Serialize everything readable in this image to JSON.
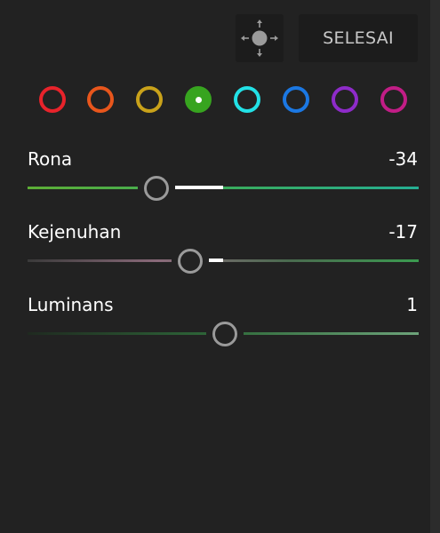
{
  "toolbar": {
    "target_icon": "target-adjust-icon",
    "done_label": "SELESAI"
  },
  "color_swatches": [
    {
      "name": "red",
      "color": "#e8232b",
      "selected": false
    },
    {
      "name": "orange",
      "color": "#e8561c",
      "selected": false
    },
    {
      "name": "yellow",
      "color": "#c9a21a",
      "selected": false
    },
    {
      "name": "green",
      "color": "#37a41f",
      "selected": true
    },
    {
      "name": "aqua",
      "color": "#22e1e6",
      "selected": false
    },
    {
      "name": "blue",
      "color": "#1b78e3",
      "selected": false
    },
    {
      "name": "purple",
      "color": "#8e2bc9",
      "selected": false
    },
    {
      "name": "magenta",
      "color": "#c21d86",
      "selected": false
    }
  ],
  "sliders": [
    {
      "label": "Rona",
      "value": "-34",
      "level": -34,
      "min": -100,
      "max": 100,
      "track_colors": [
        "#5dae36",
        "#3aac5c",
        "#25ae93"
      ]
    },
    {
      "label": "Kejenuhan",
      "value": "-17",
      "level": -17,
      "min": -100,
      "max": 100,
      "track_colors": [
        "#3a3a3a",
        "#8a6a7a",
        "#4a6a4f",
        "#3b9b50"
      ]
    },
    {
      "label": "Luminans",
      "value": "1",
      "level": 1,
      "min": -100,
      "max": 100,
      "track_colors": [
        "#1f2a20",
        "#2f6a3a",
        "#6da37a"
      ]
    }
  ]
}
